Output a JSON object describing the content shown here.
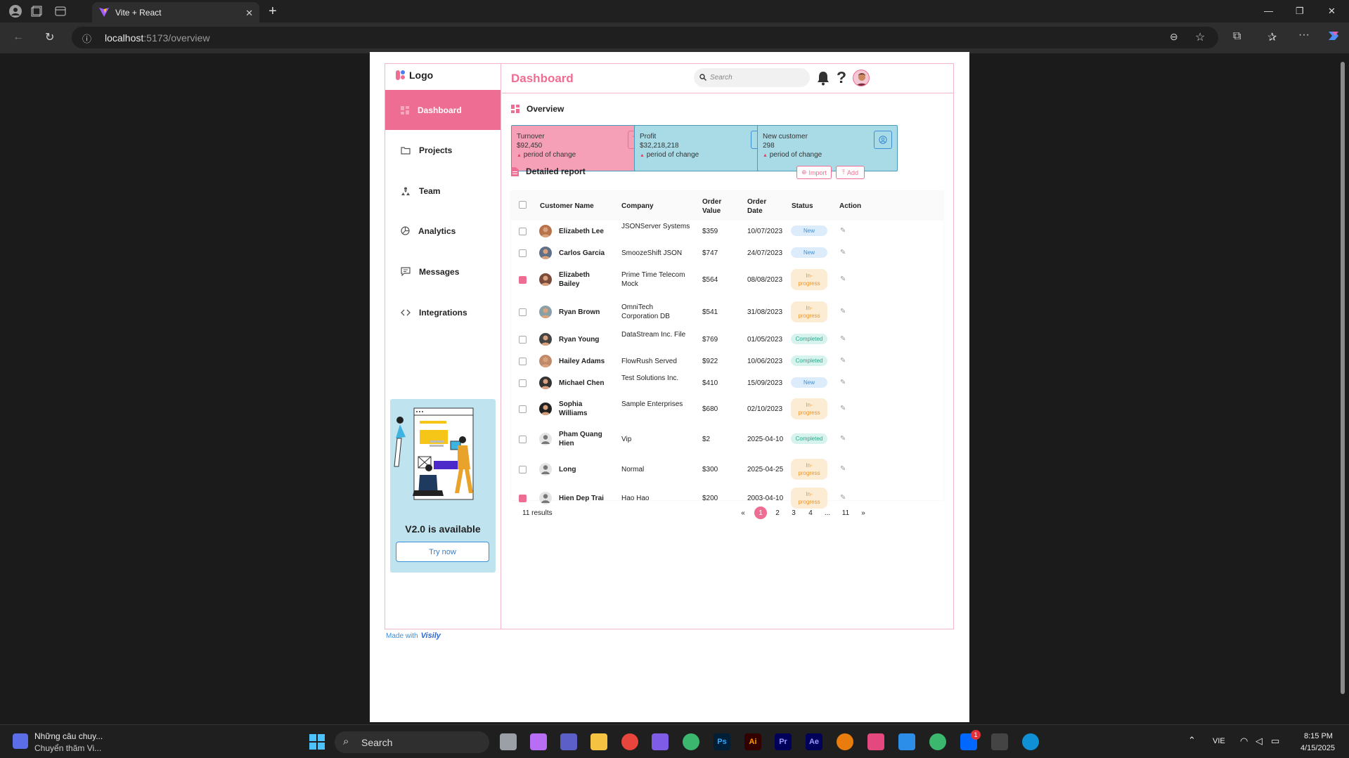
{
  "browser": {
    "tab_title": "Vite + React",
    "url_host": "localhost",
    "url_path": ":5173/overview"
  },
  "sidebar": {
    "logo": "Logo",
    "items": [
      {
        "label": "Dashboard",
        "icon": "grid-icon"
      },
      {
        "label": "Projects",
        "icon": "folder-icon"
      },
      {
        "label": "Team",
        "icon": "team-icon"
      },
      {
        "label": "Analytics",
        "icon": "pie-chart-icon"
      },
      {
        "label": "Messages",
        "icon": "message-icon"
      },
      {
        "label": "Integrations",
        "icon": "code-icon"
      }
    ],
    "promo": {
      "title": "V2.0 is available",
      "button": "Try now"
    }
  },
  "header": {
    "title": "Dashboard",
    "search_placeholder": "Search"
  },
  "overview": {
    "title": "Overview",
    "cards": [
      {
        "label": "Turnover",
        "value": "$92,450",
        "change": "period of change"
      },
      {
        "label": "Profit",
        "value": "$32,218,218",
        "change": "period of change"
      },
      {
        "label": "New customer",
        "value": "298",
        "change": "period of change"
      }
    ]
  },
  "report": {
    "title": "Detailed report",
    "import": "Import",
    "add": "Add",
    "columns": [
      "Customer Name",
      "Company",
      "Order Value",
      "Order Date",
      "Status",
      "Action"
    ],
    "rows": [
      {
        "name": "Elizabeth Lee",
        "company": "JSONServer Systems",
        "value": "$359",
        "date": "10/07/2023",
        "status": "New",
        "checked": false
      },
      {
        "name": "Carlos Garcia",
        "company": "SmoozeShift JSON",
        "value": "$747",
        "date": "24/07/2023",
        "status": "New",
        "checked": false
      },
      {
        "name": "Elizabeth Bailey",
        "company": "Prime Time Telecom Mock",
        "value": "$564",
        "date": "08/08/2023",
        "status": "In-progress",
        "checked": true
      },
      {
        "name": "Ryan Brown",
        "company": "OmniTech Corporation DB",
        "value": "$541",
        "date": "31/08/2023",
        "status": "In-progress",
        "checked": false
      },
      {
        "name": "Ryan Young",
        "company": "DataStream Inc. File",
        "value": "$769",
        "date": "01/05/2023",
        "status": "Completed",
        "checked": false
      },
      {
        "name": "Hailey Adams",
        "company": "FlowRush Served",
        "value": "$922",
        "date": "10/06/2023",
        "status": "Completed",
        "checked": false
      },
      {
        "name": "Michael Chen",
        "company": "Test Solutions Inc.",
        "value": "$410",
        "date": "15/09/2023",
        "status": "New",
        "checked": false
      },
      {
        "name": "Sophia Williams",
        "company": "Sample Enterprises",
        "value": "$680",
        "date": "02/10/2023",
        "status": "In-progress",
        "checked": false
      },
      {
        "name": "Pham Quang Hien",
        "company": "Vip",
        "value": "$2",
        "date": "2025-04-10",
        "status": "Completed",
        "checked": false
      },
      {
        "name": "Long",
        "company": "Normal",
        "value": "$300",
        "date": "2025-04-25",
        "status": "In-progress",
        "checked": false
      },
      {
        "name": "Hien Dep Trai",
        "company": "Hao Hao",
        "value": "$200",
        "date": "2003-04-10",
        "status": "In-progress",
        "checked": true
      }
    ],
    "results": "11 results",
    "pages": [
      "«",
      "1",
      "2",
      "3",
      "4",
      "...",
      "11",
      "»"
    ],
    "current_page": "1"
  },
  "made_with": "Made with",
  "brand": "Visily",
  "taskbar": {
    "news_title": "Những câu chuy...",
    "news_sub": "Chuyển thăm Vi...",
    "search": "Search",
    "lang": "VIE",
    "time": "8:15 PM",
    "date": "4/15/2025",
    "notification_count": "1"
  }
}
